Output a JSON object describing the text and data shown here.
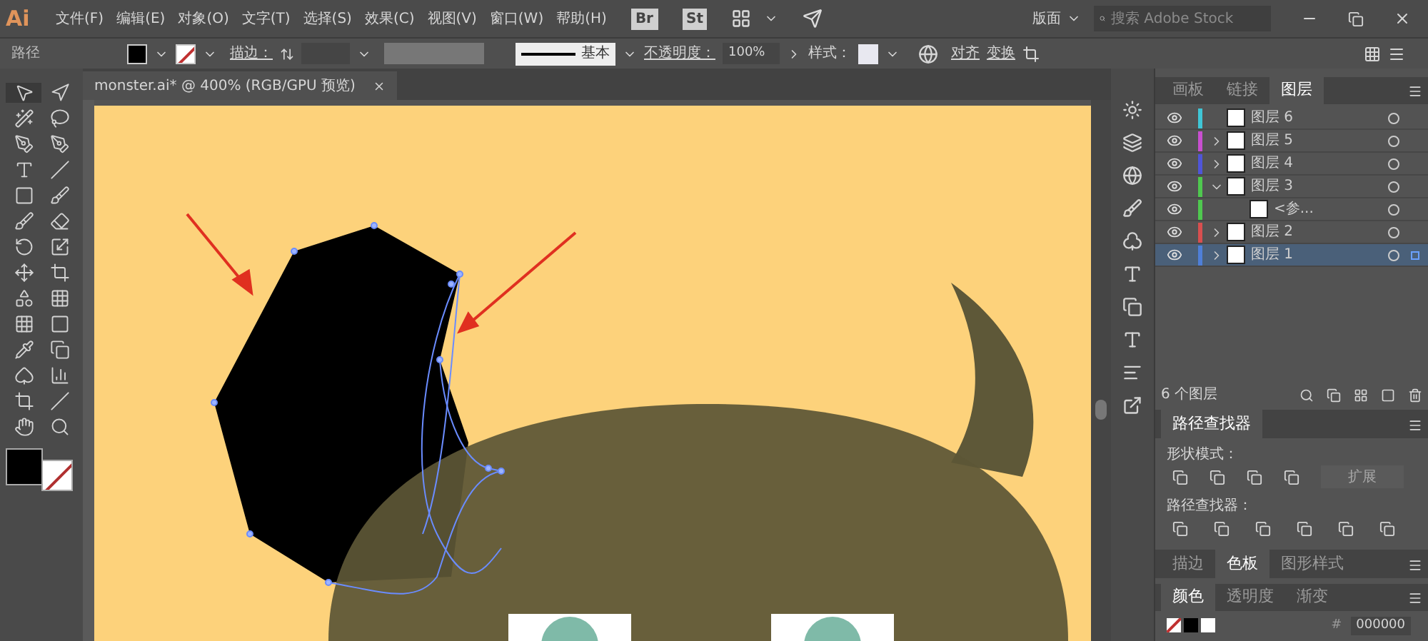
{
  "app": {
    "logo": "Ai",
    "menu": [
      "文件(F)",
      "编辑(E)",
      "对象(O)",
      "文字(T)",
      "选择(S)",
      "效果(C)",
      "视图(V)",
      "窗口(W)",
      "帮助(H)"
    ],
    "bridges": [
      "Br",
      "St"
    ],
    "workspace": "版面",
    "search": {
      "placeholder": "搜索 Adobe Stock"
    }
  },
  "control_bar": {
    "selection": "路径",
    "stroke_label": "描边：",
    "stroke_style": "基本",
    "opacity_label": "不透明度：",
    "opacity": "100%",
    "style_label": "样式：",
    "align": "对齐",
    "transform": "变换"
  },
  "document_tab": {
    "title": "monster.ai* @ 400% (RGB/GPU 预览)"
  },
  "layers_panel": {
    "tabs": [
      {
        "label": "画板",
        "selected": false
      },
      {
        "label": "链接",
        "selected": false
      },
      {
        "label": "图层",
        "selected": true
      }
    ],
    "layers": [
      {
        "name": "图层 6",
        "color": "#3fc6d6",
        "visible": true,
        "selected": false
      },
      {
        "name": "图层 5",
        "color": "#c84fd0",
        "visible": true,
        "expanded": false,
        "selected": false
      },
      {
        "name": "图层 4",
        "color": "#4f55d8",
        "visible": true,
        "expanded": false,
        "selected": false
      },
      {
        "name": "图层 3",
        "color": "#4fc84f",
        "visible": true,
        "expanded": true,
        "selected": false,
        "children": [
          {
            "name": "<参...",
            "color": "#4fc84f",
            "visible": true,
            "selected": false
          }
        ]
      },
      {
        "name": "图层 2",
        "color": "#d84f4f",
        "visible": true,
        "expanded": false,
        "selected": false
      },
      {
        "name": "图层 1",
        "color": "#4f7fd8",
        "visible": true,
        "expanded": false,
        "selected": true
      }
    ],
    "count": "6 个图层"
  },
  "pathfinder_panel": {
    "title": "路径查找器",
    "shape_modes_label": "形状模式：",
    "expand_button": {
      "label": "扩展",
      "disabled": true
    },
    "pathfinders_label": "路径查找器："
  },
  "swatch_tabs": [
    {
      "label": "描边",
      "selected": false
    },
    {
      "label": "色板",
      "selected": true
    },
    {
      "label": "图形样式",
      "selected": false
    }
  ],
  "color_panel": {
    "tabs": [
      {
        "label": "颜色",
        "selected": true
      },
      {
        "label": "透明度",
        "selected": false
      },
      {
        "label": "渐变",
        "selected": false
      }
    ],
    "hex_label": "#",
    "hex": "000000"
  }
}
